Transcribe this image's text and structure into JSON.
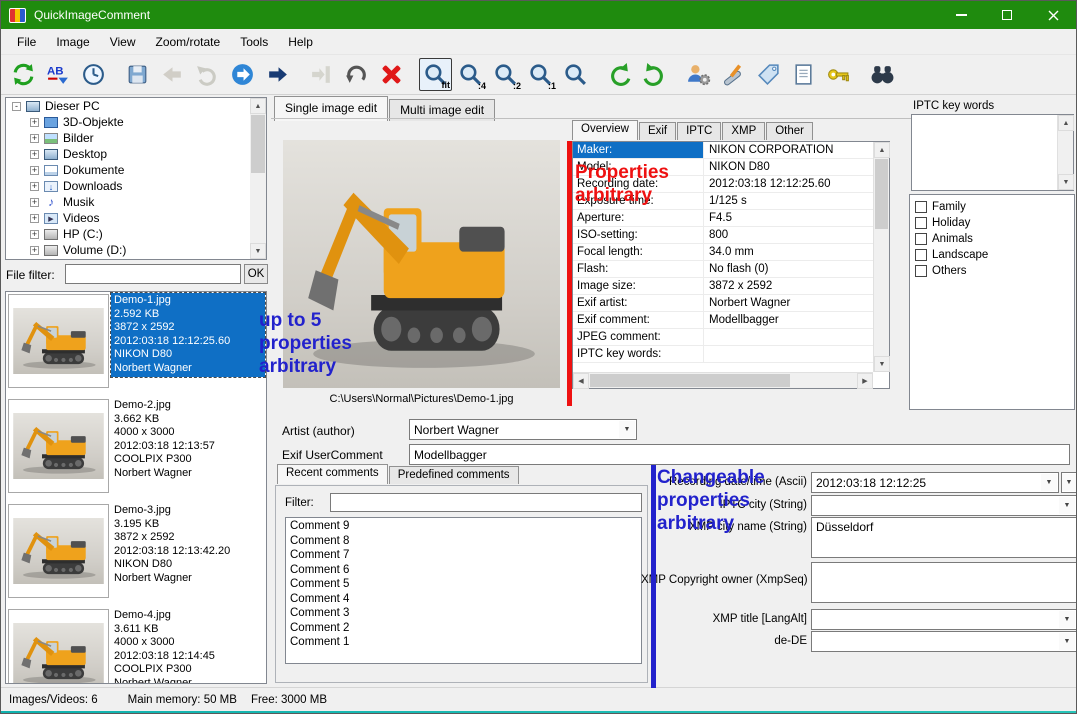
{
  "window": {
    "title": "QuickImageComment"
  },
  "menu": {
    "items": [
      "File",
      "Image",
      "View",
      "Zoom/rotate",
      "Tools",
      "Help"
    ]
  },
  "toolbar": {
    "labels": {
      "spell": "AB",
      "fit": "fit",
      "z14": ":4",
      "z12": ":2",
      "z11": ":1"
    },
    "icons": [
      "refresh",
      "spellcheck",
      "clock",
      "save",
      "back",
      "undo",
      "forward",
      "next-image",
      "import",
      "rotate",
      "delete",
      "zoom-fit",
      "zoom-1-4",
      "zoom-1-2",
      "zoom-1-1",
      "zoom",
      "rotate-left",
      "rotate-right",
      "user-settings",
      "tools",
      "tag",
      "document",
      "key",
      "binoculars"
    ]
  },
  "sidebar": {
    "tree": [
      {
        "label": "Dieser PC",
        "icon": "computer"
      },
      {
        "label": "3D-Objekte",
        "icon": "folder-3d"
      },
      {
        "label": "Bilder",
        "icon": "pictures"
      },
      {
        "label": "Desktop",
        "icon": "desktop"
      },
      {
        "label": "Dokumente",
        "icon": "documents"
      },
      {
        "label": "Downloads",
        "icon": "downloads"
      },
      {
        "label": "Musik",
        "icon": "music"
      },
      {
        "label": "Videos",
        "icon": "videos"
      },
      {
        "label": "HP (C:)",
        "icon": "drive"
      },
      {
        "label": "Volume (D:)",
        "icon": "drive"
      }
    ],
    "file_filter": {
      "label": "File filter:",
      "value": "",
      "ok": "OK"
    }
  },
  "files": [
    {
      "name": "Demo-1.jpg",
      "size": "2.592 KB",
      "dims": "3872 x 2592",
      "date": "2012:03:18 12:12:25.60",
      "camera": "NIKON D80",
      "artist": "Norbert Wagner"
    },
    {
      "name": "Demo-2.jpg",
      "size": "3.662 KB",
      "dims": "4000 x 3000",
      "date": "2012:03:18 12:13:57",
      "camera": "COOLPIX P300",
      "artist": "Norbert Wagner"
    },
    {
      "name": "Demo-3.jpg",
      "size": "3.195 KB",
      "dims": "3872 x 2592",
      "date": "2012:03:18 12:13:42.20",
      "camera": "NIKON D80",
      "artist": "Norbert Wagner"
    },
    {
      "name": "Demo-4.jpg",
      "size": "3.611 KB",
      "dims": "4000 x 3000",
      "date": "2012:03:18 12:14:45",
      "camera": "COOLPIX P300",
      "artist": "Norbert Wagner"
    }
  ],
  "edit_tabs": {
    "single": "Single image edit",
    "multi": "Multi image edit"
  },
  "preview": {
    "path": "C:\\Users\\Normal\\Pictures\\Demo-1.jpg"
  },
  "properties": {
    "tabs": [
      "Overview",
      "Exif",
      "IPTC",
      "XMP",
      "Other"
    ],
    "rows": [
      {
        "label": "Maker:",
        "value": "NIKON CORPORATION"
      },
      {
        "label": "Model:",
        "value": "NIKON D80"
      },
      {
        "label": "Recording date:",
        "value": "2012:03:18 12:12:25.60"
      },
      {
        "label": "Exposure time:",
        "value": "1/125 s"
      },
      {
        "label": "Aperture:",
        "value": "F4.5"
      },
      {
        "label": "ISO-setting:",
        "value": "800"
      },
      {
        "label": "Focal length:",
        "value": "34.0 mm"
      },
      {
        "label": "Flash:",
        "value": "No flash (0)"
      },
      {
        "label": "Image size:",
        "value": "3872 x 2592"
      },
      {
        "label": "Exif artist:",
        "value": "Norbert Wagner"
      },
      {
        "label": "Exif comment:",
        "value": "Modellbagger"
      },
      {
        "label": "JPEG comment:",
        "value": ""
      },
      {
        "label": "IPTC key words:",
        "value": ""
      }
    ]
  },
  "artist": {
    "label": "Artist (author)",
    "value": "Norbert Wagner"
  },
  "usercomment": {
    "label": "Exif UserComment",
    "value": "Modellbagger"
  },
  "comments": {
    "tab_recent": "Recent comments",
    "tab_predefined": "Predefined comments",
    "filter_label": "Filter:",
    "filter_value": "",
    "items": [
      "Comment 9",
      "Comment 8",
      "Comment 7",
      "Comment 6",
      "Comment 5",
      "Comment 4",
      "Comment 3",
      "Comment 2",
      "Comment 1"
    ]
  },
  "changeable": {
    "row1_label": "Recording date/time (Ascii)",
    "row1_value": "2012:03:18 12:12:25",
    "row2_label": "IPTC city (String)",
    "row2_value": "",
    "row3_label": "XMP city name (String)",
    "row3_value": "Düsseldorf",
    "row4_label": "XMP Copyright owner (XmpSeq)",
    "row4_value": "",
    "row5_label": "XMP title [LangAlt]",
    "row5_value": "",
    "row6_label": "de-DE",
    "row6_value": ""
  },
  "keywords": {
    "title": "IPTC key words",
    "options": [
      "Family",
      "Holiday",
      "Animals",
      "Landscape",
      "Others"
    ]
  },
  "status": {
    "images": "Images/Videos: 6",
    "memory": "Main memory: 50 MB",
    "free": "Free: 3000 MB"
  },
  "annotations": {
    "files": [
      "up to 5",
      "properties",
      "arbitrary"
    ],
    "props": [
      "Properties",
      "arbitrary"
    ],
    "changeable": [
      "Changeable",
      "properties",
      "arbitrary"
    ]
  },
  "colors": {
    "titlebar_green": "#1f8b0e",
    "selection_blue": "#0f6fc5",
    "annotation_blue": "#2222cc",
    "annotation_red": "#ee1111"
  }
}
